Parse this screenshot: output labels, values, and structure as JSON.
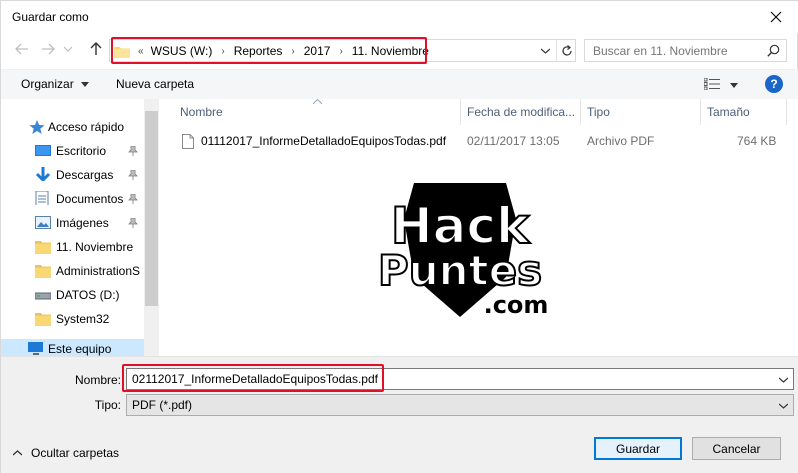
{
  "window": {
    "title": "Guardar como"
  },
  "nav": {
    "breadcrumb": [
      "WSUS (W:)",
      "Reportes",
      "2017",
      "11. Noviembre"
    ],
    "overflow_chevron": "«",
    "search_placeholder": "Buscar en 11. Noviembre"
  },
  "toolbar": {
    "organize_label": "Organizar",
    "new_folder_label": "Nueva carpeta"
  },
  "sidebar": {
    "items": [
      {
        "label": "Acceso rápido",
        "icon": "star-icon"
      },
      {
        "label": "Escritorio",
        "icon": "desktop-icon",
        "pinned": true
      },
      {
        "label": "Descargas",
        "icon": "download-icon",
        "pinned": true
      },
      {
        "label": "Documentos",
        "icon": "documents-icon",
        "pinned": true
      },
      {
        "label": "Imágenes",
        "icon": "pictures-icon",
        "pinned": true
      },
      {
        "label": "11. Noviembre",
        "icon": "folder-icon"
      },
      {
        "label": "AdministrationS",
        "icon": "folder-icon"
      },
      {
        "label": "DATOS (D:)",
        "icon": "drive-icon"
      },
      {
        "label": "System32",
        "icon": "folder-icon"
      },
      {
        "label": "Este equipo",
        "icon": "computer-icon"
      }
    ]
  },
  "columns": {
    "name": "Nombre",
    "date": "Fecha de modifica...",
    "type": "Tipo",
    "size": "Tamaño"
  },
  "files": [
    {
      "name": "01112017_InformeDetalladoEquiposTodas.pdf",
      "date": "02/11/2017 13:05",
      "type": "Archivo PDF",
      "size": "764 KB"
    }
  ],
  "watermark": {
    "line1": "Hack",
    "line2": "Puntes",
    "line3": ".com"
  },
  "form": {
    "name_label": "Nombre:",
    "name_value": "02112017_InformeDetalladoEquiposTodas.pdf",
    "type_label": "Tipo:",
    "type_value": "PDF (*.pdf)"
  },
  "footer": {
    "hide_folders_label": "Ocultar carpetas",
    "save_label": "Guardar",
    "cancel_label": "Cancelar"
  },
  "colors": {
    "highlight": "#e0102a",
    "accent": "#0078d7",
    "header_text": "#4c607a",
    "folder": "#f8d775"
  }
}
